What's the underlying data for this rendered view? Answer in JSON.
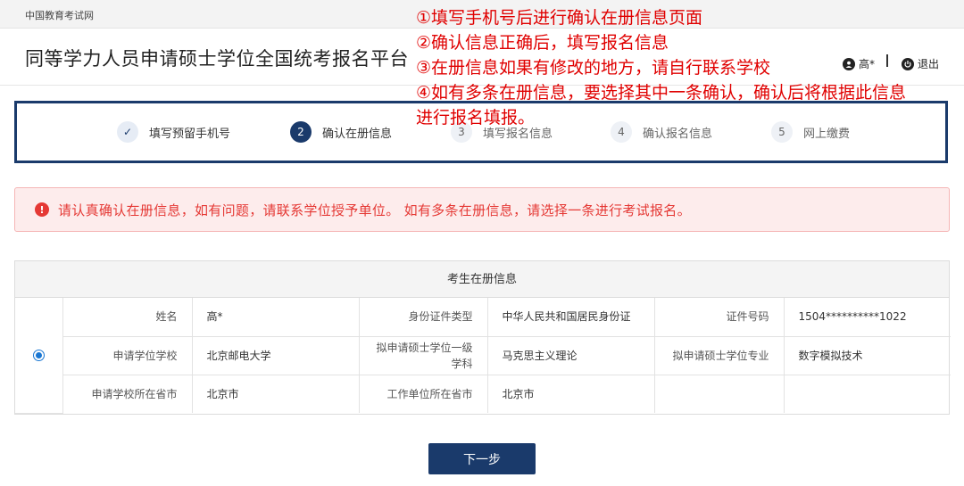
{
  "topbar": {
    "site_name": "中国教育考试网"
  },
  "header": {
    "title": "同等学力人员申请硕士学位全国统考报名平台",
    "user_name": "高*",
    "logout_label": "退出"
  },
  "annotation": {
    "lines": [
      "①填写手机号后进行确认在册信息页面",
      "②确认信息正确后，填写报名信息",
      "③在册信息如果有修改的地方，请自行联系学校",
      "④如有多条在册信息，要选择其中一条确认，确认后将根据此信息",
      "进行报名填报。"
    ],
    "color": "#e00000"
  },
  "steps": [
    {
      "num": "✓",
      "label": "填写预留手机号",
      "state": "done"
    },
    {
      "num": "2",
      "label": "确认在册信息",
      "state": "active"
    },
    {
      "num": "3",
      "label": "填写报名信息",
      "state": "pending"
    },
    {
      "num": "4",
      "label": "确认报名信息",
      "state": "pending"
    },
    {
      "num": "5",
      "label": "网上缴费",
      "state": "pending"
    }
  ],
  "alert": {
    "text": "请认真确认在册信息，如有问题，请联系学位授予单位。 如有多条在册信息，请选择一条进行考试报名。",
    "icon": "exclamation-icon"
  },
  "info": {
    "heading": "考生在册信息",
    "rows": [
      {
        "l1": "姓名",
        "v1": "高*",
        "l2": "身份证件类型",
        "v2": "中华人民共和国居民身份证",
        "l3": "证件号码",
        "v3": "1504**********1022"
      },
      {
        "l1": "申请学位学校",
        "v1": "北京邮电大学",
        "l2": "拟申请硕士学位一级学科",
        "v2": "马克思主义理论",
        "l3": "拟申请硕士学位专业",
        "v3": "数字模拟技术"
      },
      {
        "l1": "申请学校所在省市",
        "v1": "北京市",
        "l2": "工作单位所在省市",
        "v2": "北京市",
        "l3": "",
        "v3": ""
      }
    ],
    "selected": true
  },
  "next_button_label": "下一步",
  "colors": {
    "primary": "#1a3a6b",
    "error": "#e53935",
    "annotation": "#e00000"
  }
}
